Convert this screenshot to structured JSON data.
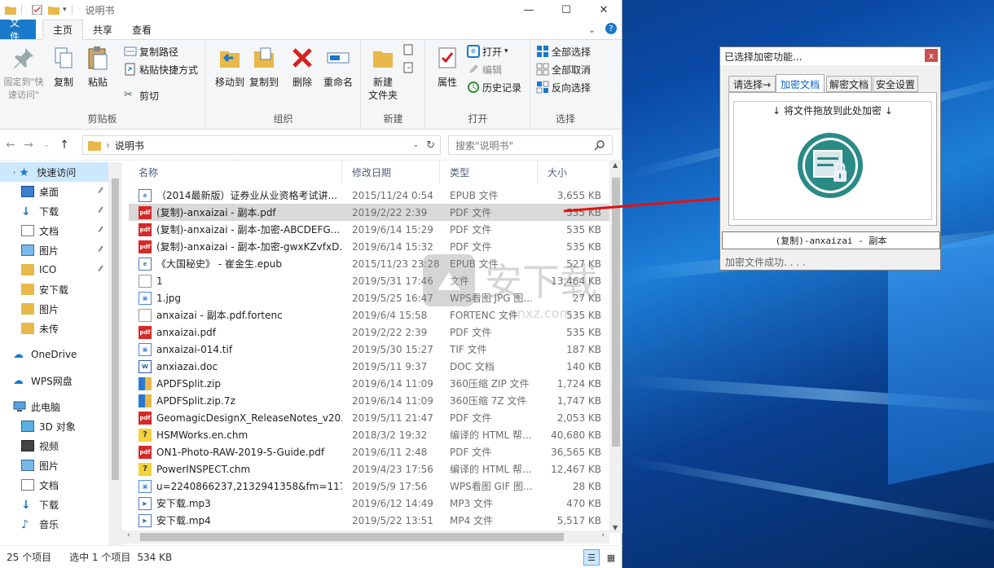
{
  "window": {
    "title": "说明书",
    "controls": {
      "minimize": "—",
      "maximize": "☐",
      "close": "✕"
    }
  },
  "tabs": {
    "file": "文件",
    "home": "主页",
    "share": "共享",
    "view": "查看"
  },
  "ribbon": {
    "clipboard": {
      "label": "剪贴板",
      "pin": "固定到\"快速访问\"",
      "copy": "复制",
      "paste": "粘贴",
      "copy_path": "复制路径",
      "paste_shortcut": "粘贴快捷方式",
      "cut": "剪切"
    },
    "organize": {
      "label": "组织",
      "move_to": "移动到",
      "copy_to": "复制到",
      "delete": "删除",
      "rename": "重命名"
    },
    "new": {
      "label": "新建",
      "new_folder": "新建\n文件夹"
    },
    "open": {
      "label": "打开",
      "properties": "属性",
      "open": "打开",
      "edit": "编辑",
      "history": "历史记录"
    },
    "select": {
      "label": "选择",
      "select_all": "全部选择",
      "select_none": "全部取消",
      "invert": "反向选择"
    }
  },
  "address": {
    "path": "说明书",
    "search_placeholder": "搜索\"说明书\""
  },
  "nav": {
    "quick_access": "快速访问",
    "items": [
      {
        "label": "桌面",
        "icon": "desktop-icon",
        "pinned": true
      },
      {
        "label": "下载",
        "icon": "download-icon",
        "pinned": true
      },
      {
        "label": "文档",
        "icon": "document-icon",
        "pinned": true
      },
      {
        "label": "图片",
        "icon": "picture-icon",
        "pinned": true
      },
      {
        "label": "ICO",
        "icon": "folder-icon",
        "pinned": true
      },
      {
        "label": "安下载",
        "icon": "folder-icon",
        "pinned": false
      },
      {
        "label": "图片",
        "icon": "folder-icon",
        "pinned": false
      },
      {
        "label": "未传",
        "icon": "folder-icon",
        "pinned": false
      }
    ],
    "onedrive": "OneDrive",
    "wps": "WPS网盘",
    "this_pc": "此电脑",
    "pc_items": [
      {
        "label": "3D 对象",
        "icon": "3d-objects-icon"
      },
      {
        "label": "视频",
        "icon": "video-icon"
      },
      {
        "label": "图片",
        "icon": "picture-icon"
      },
      {
        "label": "文档",
        "icon": "document-icon"
      },
      {
        "label": "下载",
        "icon": "download-icon"
      },
      {
        "label": "音乐",
        "icon": "music-icon"
      }
    ]
  },
  "columns": {
    "name": "名称",
    "date": "修改日期",
    "type": "类型",
    "size": "大小"
  },
  "files": [
    {
      "name": "（2014最新版）证券业从业资格考试讲...",
      "date": "2015/11/24 0:54",
      "type": "EPUB 文件",
      "size": "3,655 KB",
      "icon": "epub"
    },
    {
      "name": "(复制)-anxaizai - 副本.pdf",
      "date": "2019/2/22 2:39",
      "type": "PDF 文件",
      "size": "535 KB",
      "icon": "pdf",
      "selected": true
    },
    {
      "name": "(复制)-anxaizai - 副本-加密-ABCDEFG...",
      "date": "2019/6/14 15:29",
      "type": "PDF 文件",
      "size": "535 KB",
      "icon": "pdf"
    },
    {
      "name": "(复制)-anxaizai - 副本-加密-gwxKZvfxD...",
      "date": "2019/6/14 15:32",
      "type": "PDF 文件",
      "size": "535 KB",
      "icon": "pdf"
    },
    {
      "name": "《大国秘史》 - 崔金生.epub",
      "date": "2015/11/23 23:28",
      "type": "EPUB 文件",
      "size": "527 KB",
      "icon": "epub"
    },
    {
      "name": "1",
      "date": "2019/5/31 17:46",
      "type": "文件",
      "size": "13,464 KB",
      "icon": "blank"
    },
    {
      "name": "1.jpg",
      "date": "2019/5/25 16:47",
      "type": "WPS看图 JPG 图...",
      "size": "27 KB",
      "icon": "image"
    },
    {
      "name": "anxaizai - 副本.pdf.fortenc",
      "date": "2019/6/4 15:58",
      "type": "FORTENC 文件",
      "size": "535 KB",
      "icon": "blank"
    },
    {
      "name": "anxaizai.pdf",
      "date": "2019/2/22 2:39",
      "type": "PDF 文件",
      "size": "535 KB",
      "icon": "pdf"
    },
    {
      "name": "anxaizai-014.tif",
      "date": "2019/5/30 15:27",
      "type": "TIF 文件",
      "size": "187 KB",
      "icon": "tif"
    },
    {
      "name": "anxiazai.doc",
      "date": "2019/5/11 9:37",
      "type": "DOC 文档",
      "size": "140 KB",
      "icon": "doc"
    },
    {
      "name": "APDFSplit.zip",
      "date": "2019/6/14 11:09",
      "type": "360压缩 ZIP 文件",
      "size": "1,724 KB",
      "icon": "zip"
    },
    {
      "name": "APDFSplit.zip.7z",
      "date": "2019/6/14 11:09",
      "type": "360压缩 7Z 文件",
      "size": "1,747 KB",
      "icon": "zip"
    },
    {
      "name": "GeomagicDesignX_ReleaseNotes_v20...",
      "date": "2019/5/11 21:47",
      "type": "PDF 文件",
      "size": "2,053 KB",
      "icon": "pdf"
    },
    {
      "name": "HSMWorks.en.chm",
      "date": "2018/3/2 19:32",
      "type": "编译的 HTML 帮...",
      "size": "40,680 KB",
      "icon": "chm"
    },
    {
      "name": "ON1-Photo-RAW-2019-5-Guide.pdf",
      "date": "2019/6/11 2:48",
      "type": "PDF 文件",
      "size": "36,565 KB",
      "icon": "pdf"
    },
    {
      "name": "PowerINSPECT.chm",
      "date": "2019/4/23 17:56",
      "type": "编译的 HTML 帮...",
      "size": "12,467 KB",
      "icon": "chm"
    },
    {
      "name": "u=2240866237,2132941358&fm=117...",
      "date": "2019/5/9 17:56",
      "type": "WPS看图 GIF 图...",
      "size": "28 KB",
      "icon": "image"
    },
    {
      "name": "安下载.mp3",
      "date": "2019/6/12 14:49",
      "type": "MP3 文件",
      "size": "470 KB",
      "icon": "media"
    },
    {
      "name": "安下载.mp4",
      "date": "2019/5/22 13:51",
      "type": "MP4 文件",
      "size": "5,517 KB",
      "icon": "media"
    }
  ],
  "status": {
    "count": "25 个项目",
    "selected": "选中 1 个项目",
    "size": "534 KB"
  },
  "dialog": {
    "title": "已选择加密功能...",
    "close": "x",
    "tabs": [
      "请选择→",
      "加密文档",
      "解密文档",
      "安全设置"
    ],
    "drop_label": "↓ 将文件拖放到此处加密 ↓",
    "file": "(复制)-anxaizai - 副本",
    "status": "加密文件成功. . . ."
  },
  "watermark": "安下载"
}
